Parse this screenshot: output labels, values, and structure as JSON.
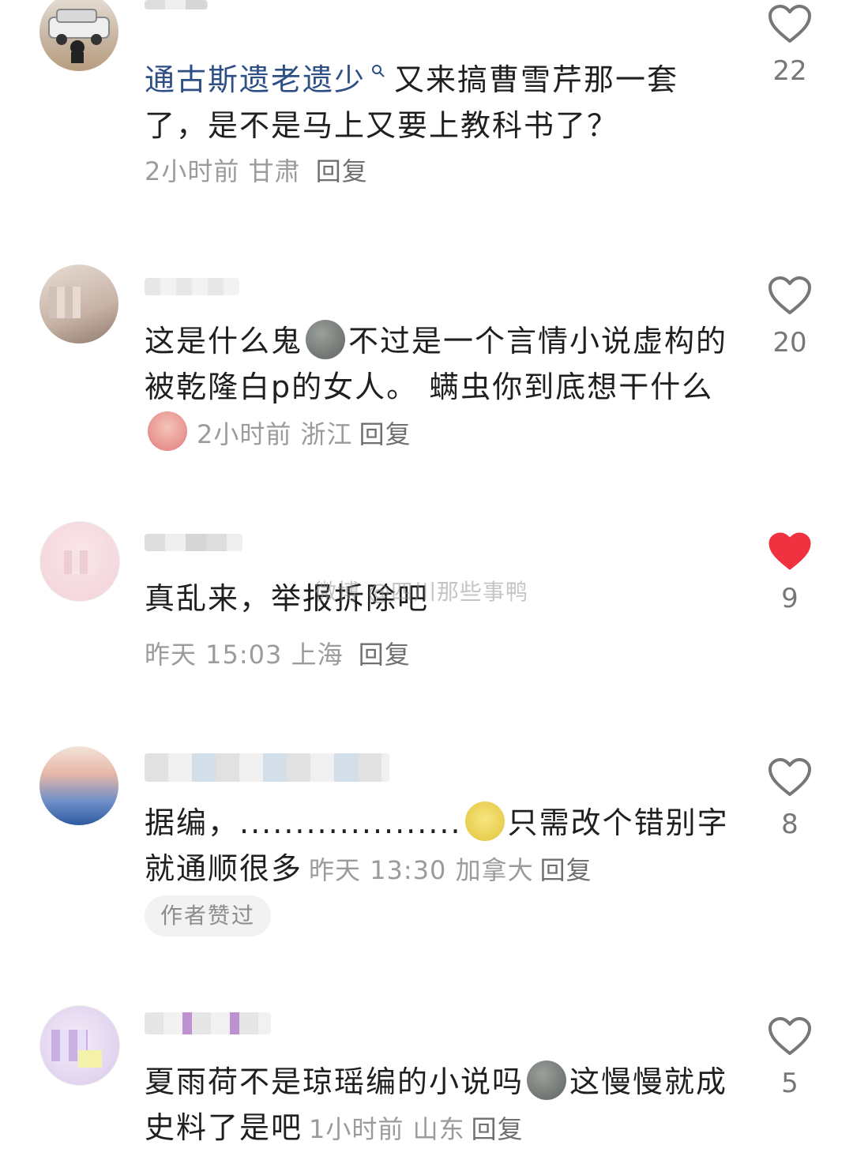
{
  "comments": [
    {
      "tag_text": "通古斯遗老遗少",
      "text": "又来搞曹雪芹那一套了，是不是马上又要上教科书了？",
      "time": "2小时前",
      "location": "甘肃",
      "reply": "回复",
      "likes": "22",
      "liked": false
    },
    {
      "text_part1": "这是什么鬼",
      "text_part2": "不过是一个言情小说虚构的被乾隆白p的女人。 螨虫你到底想干什么",
      "time": "2小时前",
      "location": "浙江",
      "reply": "回复",
      "likes": "20",
      "liked": false
    },
    {
      "text": "真乱来，举报拆除吧",
      "time": "昨天 15:03",
      "location": "上海",
      "reply": "回复",
      "likes": "9",
      "liked": true
    },
    {
      "text_part1": "据编，....................",
      "text_part2": "只需改个错别字就通顺很多",
      "time": "昨天 13:30",
      "location": "加拿大",
      "reply": "回复",
      "likes": "8",
      "liked": false,
      "badge": "作者赞过"
    },
    {
      "text_part1": "夏雨荷不是琼瑶编的小说吗",
      "text_part2": "这慢慢就成史料了是吧",
      "time": "1小时前",
      "location": "山东",
      "reply": "回复",
      "likes": "5",
      "liked": false
    }
  ],
  "watermark": "微博 @四川那些事鸭",
  "colors": {
    "accent_link": "#2d4f86",
    "like_red": "#f0313f",
    "meta_gray": "#9b9b9b"
  },
  "icons": {
    "like": "heart-icon",
    "search": "search-icon"
  }
}
